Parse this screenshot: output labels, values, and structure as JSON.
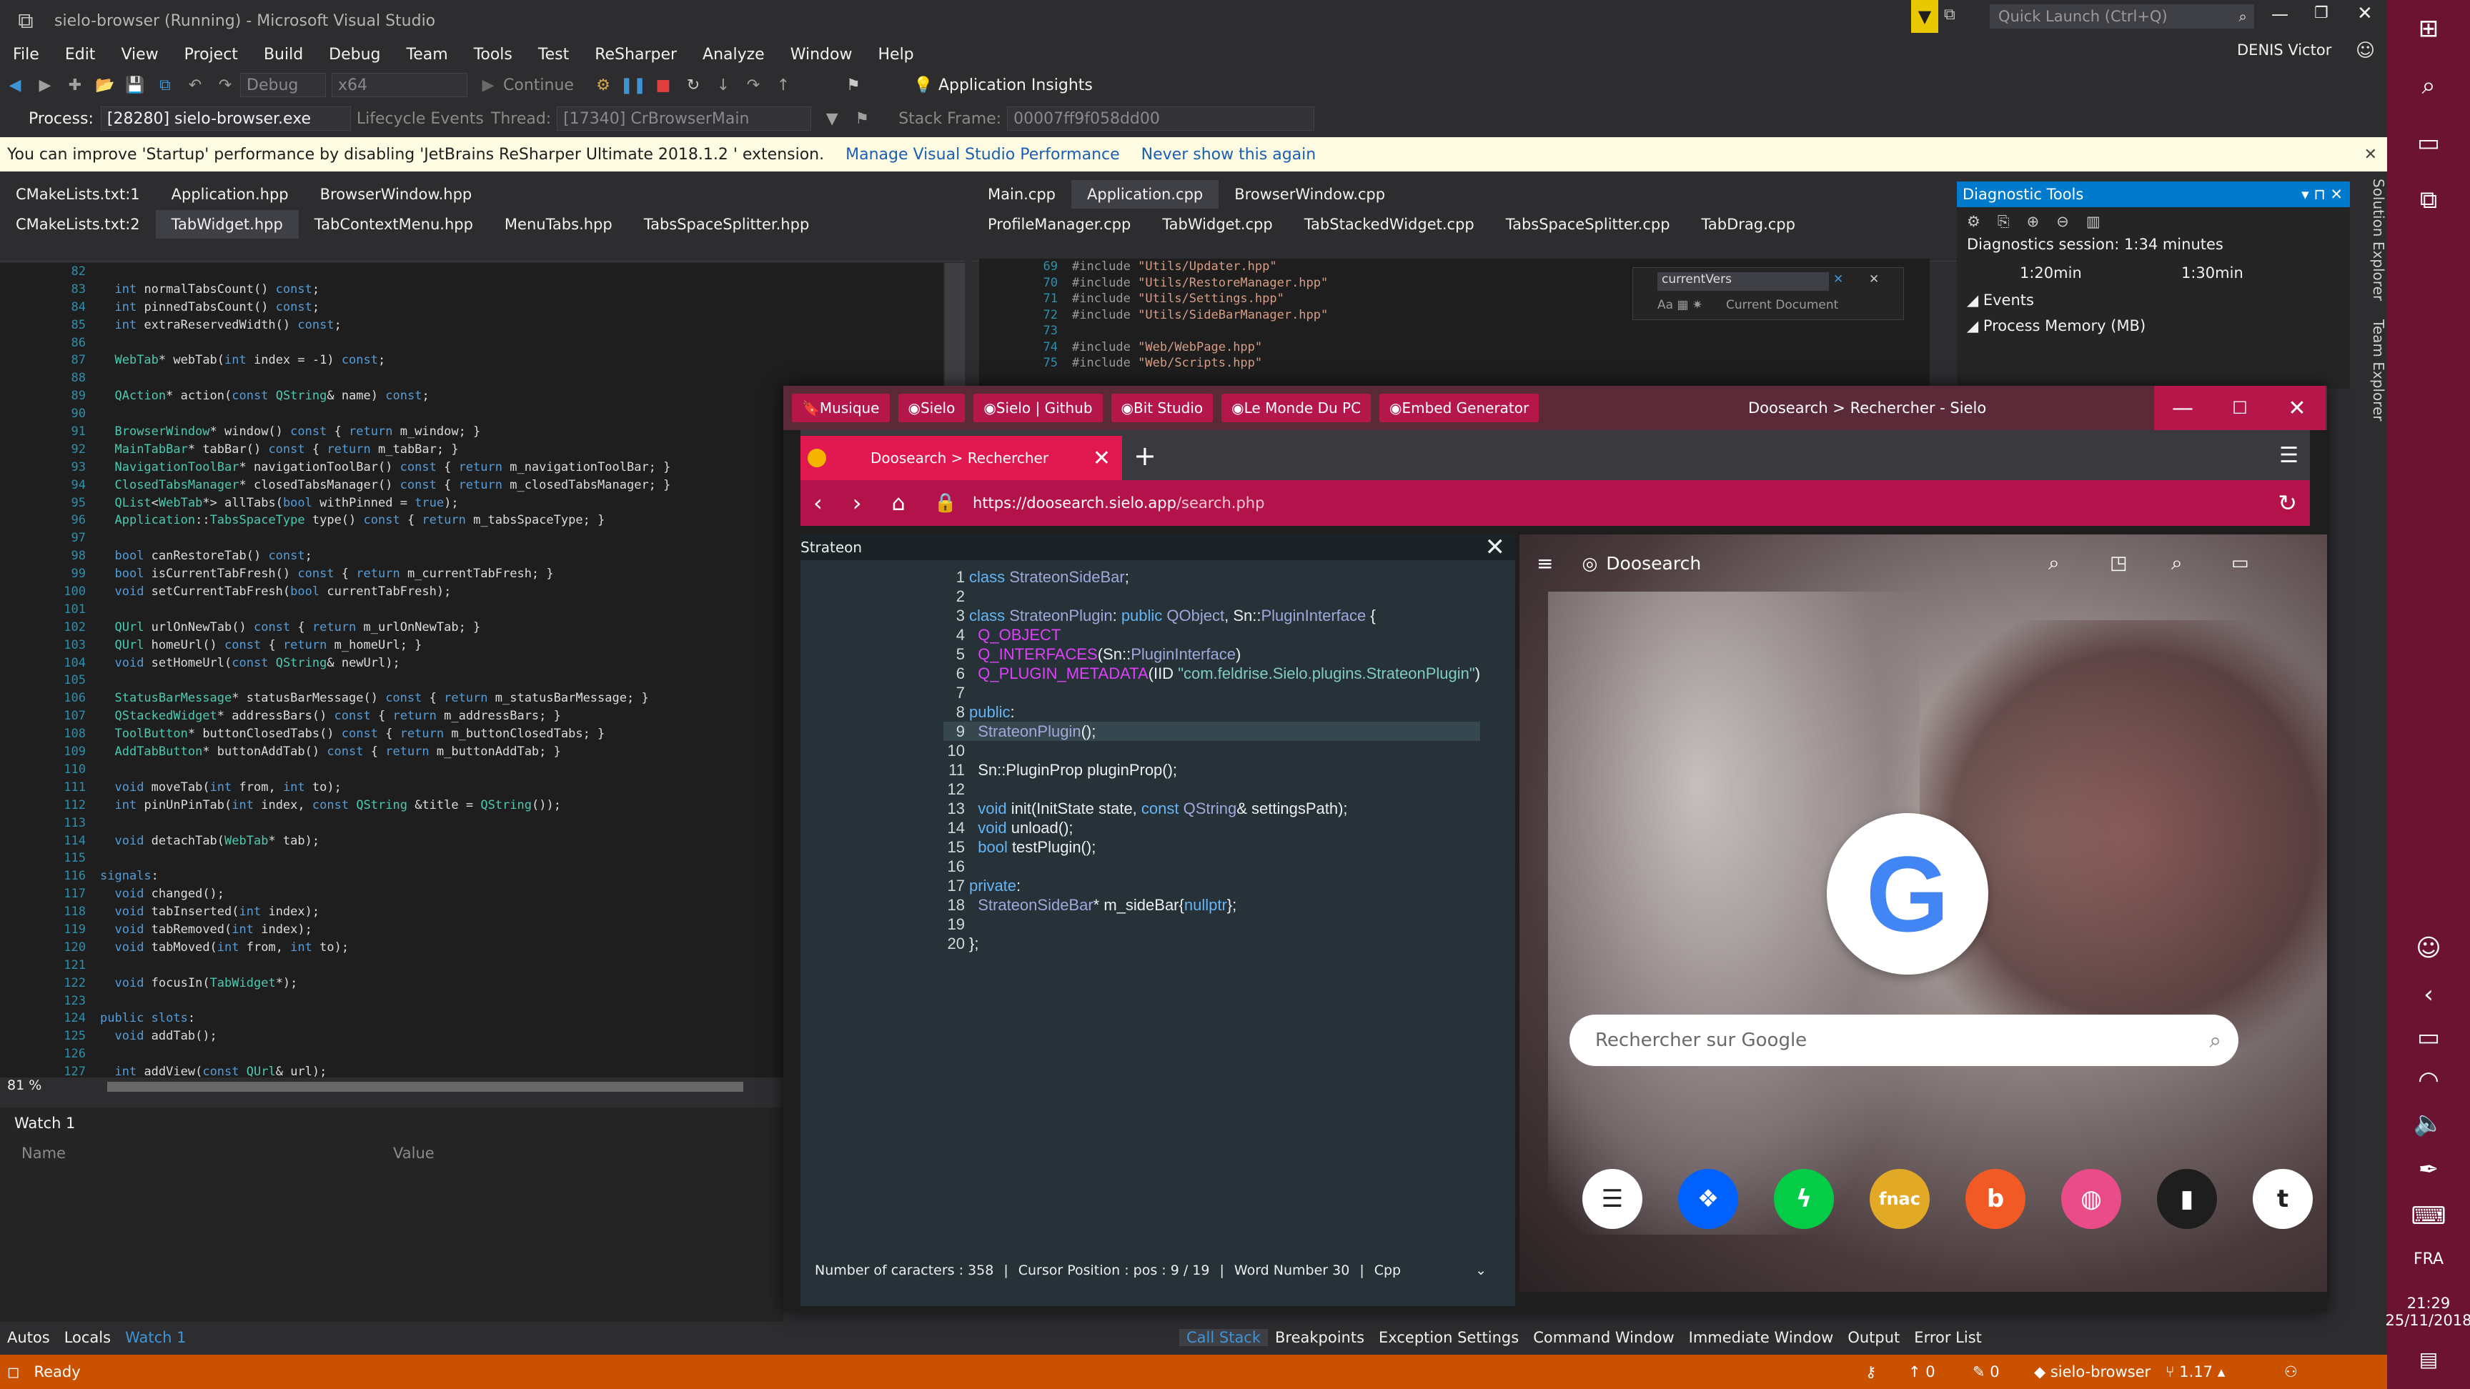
{
  "titlebar": {
    "title": "sielo-browser (Running) - Microsoft Visual Studio",
    "quick_launch": "Quick Launch (Ctrl+Q)",
    "user": "DENIS Victor"
  },
  "menu": [
    "File",
    "Edit",
    "View",
    "Project",
    "Build",
    "Debug",
    "Team",
    "Tools",
    "Test",
    "ReSharper",
    "Analyze",
    "Window",
    "Help"
  ],
  "toolbar": {
    "config": "Debug",
    "platform": "x64",
    "continue": "Continue",
    "insights": "Application Insights"
  },
  "debugbar": {
    "process_label": "Process:",
    "process": "[28280] sielo-browser.exe",
    "lifecycle": "Lifecycle Events",
    "thread_label": "Thread:",
    "thread": "[17340] CrBrowserMain",
    "stack_label": "Stack Frame:",
    "stack": "00007ff9f058dd00"
  },
  "infobar": {
    "message": "You can improve 'Startup' performance by disabling 'JetBrains ReSharper Ultimate 2018.1.2 ' extension.",
    "link1": "Manage Visual Studio Performance",
    "link2": "Never show this again"
  },
  "left_tabs_row1": [
    "CMakeLists.txt:1",
    "Application.hpp",
    "BrowserWindow.hpp"
  ],
  "left_tabs_row2": [
    "CMakeLists.txt:2",
    "TabWidget.hpp",
    "TabContextMenu.hpp",
    "MenuTabs.hpp",
    "TabsSpaceSplitter.hpp"
  ],
  "right_tabs_row1": [
    "Main.cpp",
    "Application.cpp",
    "BrowserWindow.cpp"
  ],
  "right_tabs_row2": [
    "ProfileManager.cpp",
    "TabWidget.cpp",
    "TabStackedWidget.cpp",
    "TabsSpaceSplitter.cpp",
    "TabDrag.cpp"
  ],
  "left_editor": {
    "start": 82,
    "lines": [
      "",
      "  int normalTabsCount() const;",
      "  int pinnedTabsCount() const;",
      "  int extraReservedWidth() const;",
      "",
      "  WebTab* webTab(int index = -1) const;",
      "",
      "  QAction* action(const QString& name) const;",
      "",
      "  BrowserWindow* window() const { return m_window; }",
      "  MainTabBar* tabBar() const { return m_tabBar; }",
      "  NavigationToolBar* navigationToolBar() const { return m_navigationToolBar; }",
      "  ClosedTabsManager* closedTabsManager() const { return m_closedTabsManager; }",
      "  QList<WebTab*> allTabs(bool withPinned = true);",
      "  Application::TabsSpaceType type() const { return m_tabsSpaceType; }",
      "",
      "  bool canRestoreTab() const;",
      "  bool isCurrentTabFresh() const { return m_currentTabFresh; }",
      "  void setCurrentTabFresh(bool currentTabFresh);",
      "",
      "  QUrl urlOnNewTab() const { return m_urlOnNewTab; }",
      "  QUrl homeUrl() const { return m_homeUrl; }",
      "  void setHomeUrl(const QString& newUrl);",
      "",
      "  StatusBarMessage* statusBarMessage() const { return m_statusBarMessage; }",
      "  QStackedWidget* addressBars() const { return m_addressBars; }",
      "  ToolButton* buttonClosedTabs() const { return m_buttonClosedTabs; }",
      "  AddTabButton* buttonAddTab() const { return m_buttonAddTab; }",
      "",
      "  void moveTab(int from, int to);",
      "  int pinUnPinTab(int index, const QString &title = QString());",
      "",
      "  void detachTab(WebTab* tab);",
      "",
      "signals:",
      "  void changed();",
      "  void tabInserted(int index);",
      "  void tabRemoved(int index);",
      "  void tabMoved(int from, int to);",
      "",
      "  void focusIn(TabWidget*);",
      "",
      "public slots:",
      "  void addTab();",
      "",
      "  int addView(const QUrl& url);"
    ]
  },
  "right_editor": {
    "start": 69,
    "lines": [
      "#include \"Utils/Updater.hpp\"",
      "#include \"Utils/RestoreManager.hpp\"",
      "#include \"Utils/Settings.hpp\"",
      "#include \"Utils/SideBarManager.hpp\"",
      "",
      "#include \"Web/WebPage.hpp\"",
      "#include \"Web/Scripts.hpp\""
    ]
  },
  "find": {
    "term": "currentVers",
    "scope": "Current Document"
  },
  "zoom": "81 %",
  "diagnostic": {
    "title": "Diagnostic Tools",
    "session": "Diagnostics session: 1:34 minutes",
    "t1": "1:20min",
    "t2": "1:30min",
    "events": "Events",
    "memory": "Process Memory (MB)"
  },
  "watch": {
    "title": "Watch 1",
    "col_name": "Name",
    "col_value": "Value"
  },
  "bottom_tabs_left": [
    "Autos",
    "Locals",
    "Watch 1"
  ],
  "bottom_tabs_right": [
    "Call Stack",
    "Breakpoints",
    "Exception Settings",
    "Command Window",
    "Immediate Window",
    "Output",
    "Error List"
  ],
  "status": {
    "ready": "Ready",
    "up": "0",
    "pencil": "0",
    "repo": "sielo-browser",
    "branch": "1.17"
  },
  "right_strip": {
    "label1": "Solution Explorer",
    "label2": "Team Explorer"
  },
  "windows": {
    "lang": "FRA",
    "time": "21:29",
    "date": "25/11/2018",
    "notif": "23"
  },
  "browser": {
    "bookmarks": [
      "Musique",
      "Sielo",
      "Sielo | Github",
      "Bit Studio",
      "Le Monde Du PC",
      "Embed Generator"
    ],
    "title": "Doosearch > Rechercher - Sielo",
    "tab": "Doosearch > Rechercher",
    "url_host": "https://doosearch.sielo.app",
    "url_path": "/search.php",
    "sidebar_title": "Strateon",
    "code": [
      [
        "1",
        "class StrateonSideBar;"
      ],
      [
        "2",
        ""
      ],
      [
        "3",
        "class StrateonPlugin: public QObject, Sn::PluginInterface {"
      ],
      [
        "4",
        "  Q_OBJECT"
      ],
      [
        "5",
        "  Q_INTERFACES(Sn::PluginInterface)"
      ],
      [
        "6",
        "  Q_PLUGIN_METADATA(IID \"com.feldrise.Sielo.plugins.StrateonPlugin\")"
      ],
      [
        "7",
        ""
      ],
      [
        "8",
        "public:"
      ],
      [
        "9",
        "  StrateonPlugin();"
      ],
      [
        "10",
        ""
      ],
      [
        "11",
        "  Sn::PluginProp pluginProp();"
      ],
      [
        "12",
        ""
      ],
      [
        "13",
        "  void init(InitState state, const QString& settingsPath);"
      ],
      [
        "14",
        "  void unload();"
      ],
      [
        "15",
        "  bool testPlugin();"
      ],
      [
        "16",
        ""
      ],
      [
        "17",
        "private:"
      ],
      [
        "18",
        "  StrateonSideBar* m_sideBar{nullptr};"
      ],
      [
        "19",
        ""
      ],
      [
        "20",
        "};"
      ]
    ],
    "sidebar_status": {
      "chars": "Number of caracters : 358",
      "cursor": "Cursor Position :  pos : 9 / 19",
      "words": "Word Number 30",
      "lang": "Cpp"
    },
    "page_brand": "Doosearch",
    "search_placeholder": "Rechercher sur Google",
    "speed_dials": [
      {
        "name": "menu",
        "c": "#ffffff"
      },
      {
        "name": "dropbox",
        "c": "#0061fe"
      },
      {
        "name": "deviantart",
        "c": "#05cc47"
      },
      {
        "name": "fnac",
        "c": "#e1a925"
      },
      {
        "name": "behance",
        "c": "#f15a24"
      },
      {
        "name": "dribbble",
        "c": "#ea4c89"
      },
      {
        "name": "deezer",
        "c": "#1e1e1e"
      },
      {
        "name": "tumblr",
        "c": "#ffffff"
      }
    ]
  }
}
